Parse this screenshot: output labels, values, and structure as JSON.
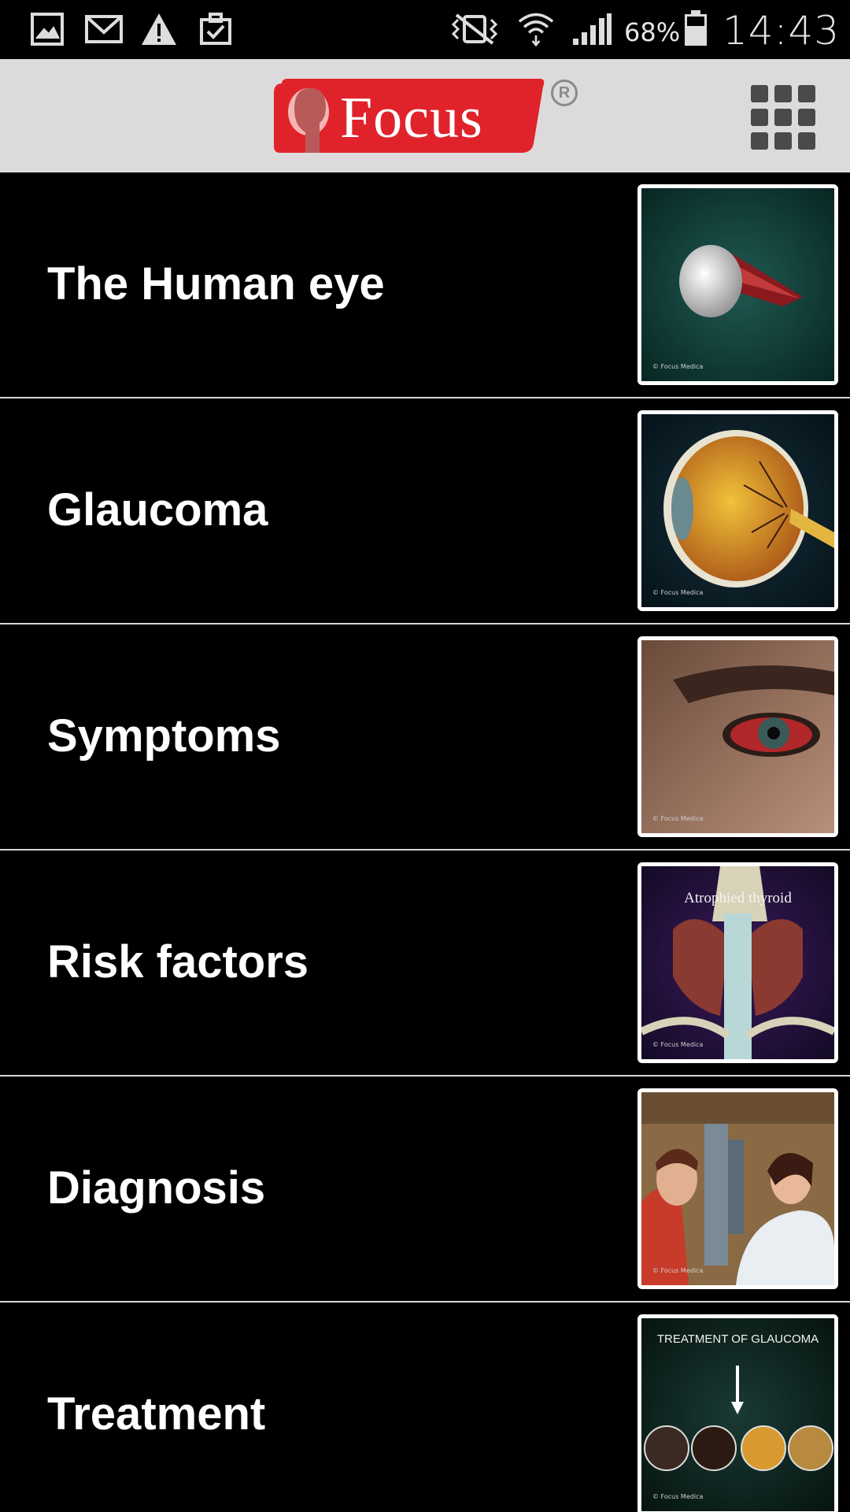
{
  "status_bar": {
    "battery_percent": "68%",
    "time": "14:43",
    "icons": [
      "gallery-icon",
      "gmail-icon",
      "warning-icon",
      "clipboard-check-icon",
      "vibrate-mute-icon",
      "wifi-icon",
      "signal-icon",
      "battery-icon"
    ]
  },
  "header": {
    "logo_text": "Focus",
    "registered_mark": "R",
    "menu_icon": "grid-menu-icon"
  },
  "items": [
    {
      "label": "The Human eye",
      "thumb_credit": "© Focus Medica"
    },
    {
      "label": "Glaucoma",
      "thumb_credit": "© Focus Medica"
    },
    {
      "label": "Symptoms",
      "thumb_credit": "© Focus Medica"
    },
    {
      "label": "Risk factors",
      "thumb_caption": "Atrophied thyroid",
      "thumb_credit": "© Focus Medica"
    },
    {
      "label": "Diagnosis",
      "thumb_credit": "© Focus Medica"
    },
    {
      "label": "Treatment",
      "thumb_caption": "TREATMENT OF GLAUCOMA",
      "thumb_credit": "© Focus Medica"
    }
  ],
  "colors": {
    "header_bg": "#dcdada",
    "logo_red": "#e0232b",
    "list_bg": "#000000",
    "divider": "#d8d8d8"
  }
}
